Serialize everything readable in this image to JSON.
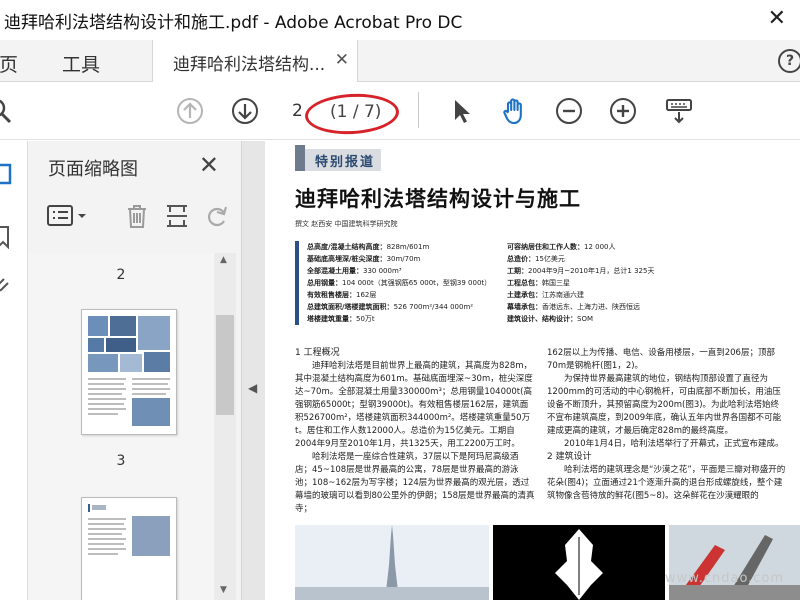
{
  "window": {
    "title": "迪拜哈利法塔结构设计和施工.pdf - Adobe Acrobat Pro DC"
  },
  "tabs": {
    "home_fragment": "主页",
    "tools": "工具",
    "document": "迪拜哈利法塔结构..."
  },
  "toolbar": {
    "page_input": "2",
    "page_count": "(1 / 7)"
  },
  "thumbnails": {
    "panel_title": "页面缩略图",
    "page_labels": [
      "2",
      "3"
    ]
  },
  "document": {
    "section_tag": "特别报道",
    "title": "迪拜哈利法塔结构设计与施工",
    "byline": "撰文  赵西安  中国建筑科学研究院",
    "specs_left": [
      {
        "k": "总高度/混凝土结构高度：",
        "v": "828m/601m"
      },
      {
        "k": "基础底高埋深/桩尖深度：",
        "v": "30m/70m"
      },
      {
        "k": "全部混凝土用量：",
        "v": "330 000m³"
      },
      {
        "k": "总用钢量：",
        "v": "104 000t（其强钢筋65 000t，型钢39 000t）"
      },
      {
        "k": "有效租售楼层：",
        "v": "162层"
      },
      {
        "k": "总建筑面积/塔楼建筑面积：",
        "v": "526 700m²/344 000m²"
      },
      {
        "k": "塔楼建筑重量：",
        "v": "50万t"
      }
    ],
    "specs_right": [
      {
        "k": "可容纳居住和工作人数：",
        "v": "12 000人"
      },
      {
        "k": "总造价：",
        "v": "15亿美元"
      },
      {
        "k": "工期：",
        "v": "2004年9月~2010年1月，总计1 325天"
      },
      {
        "k": "工程总包：",
        "v": "韩国三星"
      },
      {
        "k": "土建承包：",
        "v": "江苏南通六建"
      },
      {
        "k": "幕墙承包：",
        "v": "香港远东、上海力进、陕西恒远"
      },
      {
        "k": "建筑设计、结构设计：",
        "v": "SOM"
      }
    ],
    "left_heading": "1 工程概况",
    "left_p1": "迪拜哈利法塔是目前世界上最高的建筑，其高度为828m，其中混凝土结构高度为601m。基础底面埋深~30m，桩尖深度达~70m。全部混凝土用量330000m³；总用钢量104000t(高强钢筋65000t；型钢39000t)。有效租售楼层162层，建筑面积526700m²，塔楼建筑面积344000m²。塔楼建筑重量50万t。居住和工作人数12000人。总造价为15亿美元。工期自2004年9月至2010年1月，共1325天，用工2200万工时。",
    "left_p2": "哈利法塔是一座综合性建筑，37层以下是阿玛尼高级酒店；45~108层是世界最高的公寓，78层是世界最高的游泳池；108~162层为写字楼；124层为世界最高的观光层，透过幕墙的玻璃可以看到80公里外的伊朗；158层是世界最高的清真寺；",
    "right_p1": "162层以上为传播、电信、设备用楼层，一直到206层；顶部70m是钢桅杆(图1，2)。",
    "right_p2": "为保持世界最高建筑的地位，钢结构顶部设置了直径为1200mm的可活动的中心钢桅杆，可由底部不断加长，用油压设备不断顶升，其预留高度为200m(图3)。为此哈利法塔始终不宣布建筑高度，到2009年底，确认五年内世界各国都不可能建成更高的建筑，才最后确定828m的最终高度。",
    "right_p3": "2010年1月4日，哈利法塔举行了开幕式，正式宣布建成。",
    "right_heading": "2 建筑设计",
    "right_p4": "哈利法塔的建筑理念是“沙漠之花”，平面是三瓣对称盛开的花朵(图4)；立面通过21个逐渐升高的退台形成螺旋线，整个建筑物像含苞待放的鲜花(图5~8)。这朵鲜花在沙漠耀眼的",
    "watermark": "www.cndao.com"
  }
}
